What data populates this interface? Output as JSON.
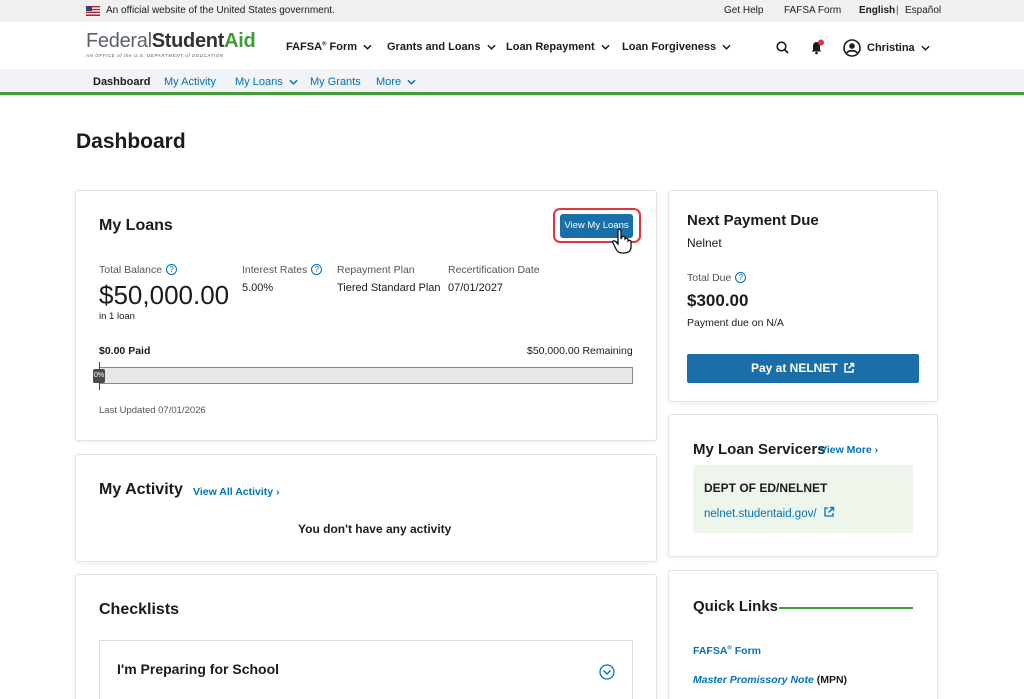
{
  "gov_banner": {
    "official_text": "An official website of the United States government.",
    "links": [
      "Get Help",
      "FAFSA Form"
    ],
    "lang_english": "English",
    "lang_separator": "|",
    "lang_spanish": "Español"
  },
  "header": {
    "logo": {
      "federal": "Federal",
      "student": "Student",
      "aid": "Aid",
      "subtitle": "AN OFFICE of the U.S. DEPARTMENT of EDUCATION"
    },
    "nav": [
      {
        "label": "FAFSA",
        "sup": "®",
        "suffix": " Form"
      },
      {
        "label": "Grants and Loans",
        "sup": "",
        "suffix": ""
      },
      {
        "label": "Loan Repayment",
        "sup": "",
        "suffix": ""
      },
      {
        "label": "Loan Forgiveness",
        "sup": "",
        "suffix": ""
      }
    ],
    "user_name": "Christina"
  },
  "sub_nav": {
    "items": [
      "Dashboard",
      "My Activity",
      "My Loans",
      "My Grants",
      "More"
    ],
    "active": "Dashboard"
  },
  "page": {
    "title": "Dashboard"
  },
  "my_loans": {
    "title": "My Loans",
    "view_button": "View My Loans",
    "total_balance_label": "Total Balance",
    "total_balance": "$50,000.00",
    "loan_count": "in 1 loan",
    "interest_label": "Interest Rates",
    "interest_value": "5.00%",
    "plan_label": "Repayment Plan",
    "plan_value": "Tiered Standard Plan",
    "recert_label": "Recertification Date",
    "recert_value": "07/01/2027",
    "paid": "$0.00 Paid",
    "remaining": "$50,000.00 Remaining",
    "progress_text": "0%",
    "progress_fraction": 0.0,
    "last_updated": "Last Updated 07/01/2026"
  },
  "activity": {
    "title": "My Activity",
    "view_all": "View All Activity",
    "empty": "You don't have any activity"
  },
  "checklists": {
    "title": "Checklists",
    "item": "I'm Preparing for School"
  },
  "next_payment": {
    "title": "Next Payment Due",
    "servicer": "Nelnet",
    "total_due_label": "Total Due",
    "total_due": "$300.00",
    "due_note": "Payment due on N/A",
    "pay_button": "Pay at NELNET"
  },
  "servicers": {
    "title": "My Loan Servicers",
    "view_more": "View More",
    "name": "DEPT OF ED/NELNET",
    "url": "nelnet.studentaid.gov/"
  },
  "quick_links": {
    "title": "Quick Links",
    "link1_main": "FAFSA",
    "link1_sup": "®",
    "link1_suffix": " Form",
    "link2_italic": "Master Promissory Note",
    "link2_suffix": " (MPN)"
  },
  "colors": {
    "brand_blue": "#1a6fa8",
    "link_blue": "#0071bc",
    "brand_green": "#3f9c35",
    "highlight_red": "#e3343c"
  }
}
